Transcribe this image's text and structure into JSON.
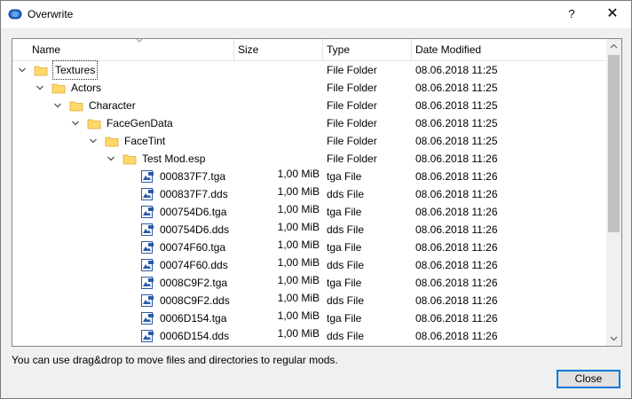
{
  "window": {
    "title": "Overwrite",
    "help_label": "?",
    "close_glyph": "✕"
  },
  "columns": {
    "name": "Name",
    "size": "Size",
    "type": "Type",
    "date": "Date Modified"
  },
  "rows": [
    {
      "name": "Textures",
      "size": "",
      "type": "File Folder",
      "date": "08.06.2018 11:25",
      "icon": "folder-icon",
      "expandable": true,
      "level": 0
    },
    {
      "name": "Actors",
      "size": "",
      "type": "File Folder",
      "date": "08.06.2018 11:25",
      "icon": "folder-icon",
      "expandable": true,
      "level": 1
    },
    {
      "name": "Character",
      "size": "",
      "type": "File Folder",
      "date": "08.06.2018 11:25",
      "icon": "folder-icon",
      "expandable": true,
      "level": 2
    },
    {
      "name": "FaceGenData",
      "size": "",
      "type": "File Folder",
      "date": "08.06.2018 11:25",
      "icon": "folder-icon",
      "expandable": true,
      "level": 3
    },
    {
      "name": "FaceTint",
      "size": "",
      "type": "File Folder",
      "date": "08.06.2018 11:25",
      "icon": "folder-icon",
      "expandable": true,
      "level": 4
    },
    {
      "name": "Test Mod.esp",
      "size": "",
      "type": "File Folder",
      "date": "08.06.2018 11:26",
      "icon": "folder-icon",
      "expandable": true,
      "level": 5
    },
    {
      "name": "000837F7.tga",
      "size": "1,00 MiB",
      "type": "tga File",
      "date": "08.06.2018 11:26",
      "icon": "image-file-icon",
      "expandable": false,
      "level": 6
    },
    {
      "name": "000837F7.dds",
      "size": "1,00 MiB",
      "type": "dds File",
      "date": "08.06.2018 11:26",
      "icon": "image-file-icon",
      "expandable": false,
      "level": 6
    },
    {
      "name": "000754D6.tga",
      "size": "1,00 MiB",
      "type": "tga File",
      "date": "08.06.2018 11:26",
      "icon": "image-file-icon",
      "expandable": false,
      "level": 6
    },
    {
      "name": "000754D6.dds",
      "size": "1,00 MiB",
      "type": "dds File",
      "date": "08.06.2018 11:26",
      "icon": "image-file-icon",
      "expandable": false,
      "level": 6
    },
    {
      "name": "00074F60.tga",
      "size": "1,00 MiB",
      "type": "tga File",
      "date": "08.06.2018 11:26",
      "icon": "image-file-icon",
      "expandable": false,
      "level": 6
    },
    {
      "name": "00074F60.dds",
      "size": "1,00 MiB",
      "type": "dds File",
      "date": "08.06.2018 11:26",
      "icon": "image-file-icon",
      "expandable": false,
      "level": 6
    },
    {
      "name": "0008C9F2.tga",
      "size": "1,00 MiB",
      "type": "tga File",
      "date": "08.06.2018 11:26",
      "icon": "image-file-icon",
      "expandable": false,
      "level": 6
    },
    {
      "name": "0008C9F2.dds",
      "size": "1,00 MiB",
      "type": "dds File",
      "date": "08.06.2018 11:26",
      "icon": "image-file-icon",
      "expandable": false,
      "level": 6
    },
    {
      "name": "0006D154.tga",
      "size": "1,00 MiB",
      "type": "tga File",
      "date": "08.06.2018 11:26",
      "icon": "image-file-icon",
      "expandable": false,
      "level": 6
    },
    {
      "name": "0006D154.dds",
      "size": "1,00 MiB",
      "type": "dds File",
      "date": "08.06.2018 11:26",
      "icon": "image-file-icon",
      "expandable": false,
      "level": 6
    }
  ],
  "hint": "You can use drag&drop to move files and directories to regular mods.",
  "close_button": "Close",
  "colors": {
    "folder": "#ffd86a",
    "accent": "#0078d7",
    "file_icon": "#2a5aa8"
  }
}
